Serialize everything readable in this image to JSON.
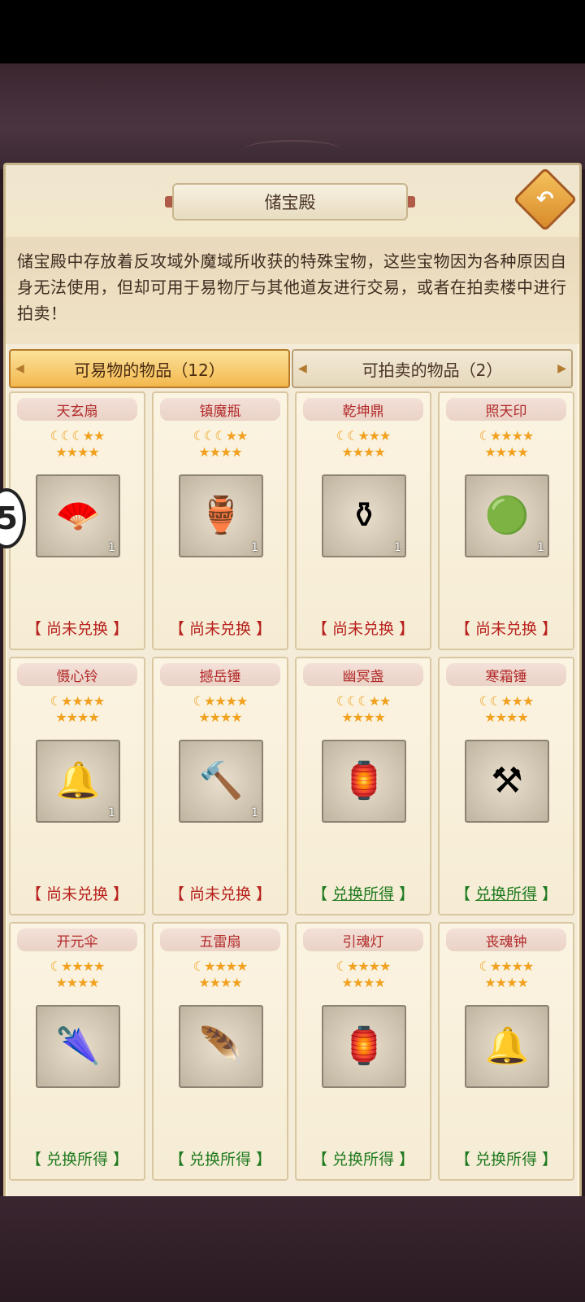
{
  "window": {
    "title": "储宝殿"
  },
  "description": "储宝殿中存放着反攻域外魔域所收获的特殊宝物，这些宝物因为各种原因自身无法使用，但却可用于易物厅与其他道友进行交易，或者在拍卖楼中进行拍卖！",
  "tabs": [
    {
      "label": "可易物的物品（12）",
      "active": true
    },
    {
      "label": "可拍卖的物品（2）",
      "active": false
    }
  ],
  "side_badge": "5",
  "items": [
    {
      "name": "天玄扇",
      "stars_row1": "☾☾☾★★",
      "stars_row2": "★★★★",
      "icon": "fan-icon",
      "glyph": "🪭",
      "count": "1",
      "status": "【 尚未兑换 】",
      "status_type": "pending"
    },
    {
      "name": "镇魔瓶",
      "stars_row1": "☾☾☾★★",
      "stars_row2": "★★★★",
      "icon": "vase-icon",
      "glyph": "🏺",
      "count": "1",
      "status": "【 尚未兑换 】",
      "status_type": "pending"
    },
    {
      "name": "乾坤鼎",
      "stars_row1": "☾☾★★★",
      "stars_row2": "★★★★",
      "icon": "cauldron-icon",
      "glyph": "⚱",
      "count": "1",
      "status": "【 尚未兑换 】",
      "status_type": "pending"
    },
    {
      "name": "照天印",
      "stars_row1": "☾★★★★",
      "stars_row2": "★★★★",
      "icon": "seal-icon",
      "glyph": "🟢",
      "count": "1",
      "status": "【 尚未兑换 】",
      "status_type": "pending"
    },
    {
      "name": "慑心铃",
      "stars_row1": "☾★★★★",
      "stars_row2": "★★★★",
      "icon": "bell-icon",
      "glyph": "🔔",
      "count": "1",
      "status": "【 尚未兑换 】",
      "status_type": "pending"
    },
    {
      "name": "撼岳锤",
      "stars_row1": "☾★★★★",
      "stars_row2": "★★★★",
      "icon": "hammer-icon",
      "glyph": "🔨",
      "count": "1",
      "status": "【 尚未兑换 】",
      "status_type": "pending"
    },
    {
      "name": "幽冥盏",
      "stars_row1": "☾☾☾★★",
      "stars_row2": "★★★★",
      "icon": "lantern-icon",
      "glyph": "🏮",
      "count": "",
      "status_open": "【 ",
      "status_link": "兑换所得",
      "status_close": " 】",
      "status": "",
      "status_type": "done"
    },
    {
      "name": "寒霜锤",
      "stars_row1": "☾☾★★★",
      "stars_row2": "★★★★",
      "icon": "axe-icon",
      "glyph": "⚒",
      "count": "",
      "status_open": "【 ",
      "status_link": "兑换所得",
      "status_close": " 】",
      "status": "",
      "status_type": "done"
    },
    {
      "name": "开元伞",
      "stars_row1": "☾★★★★",
      "stars_row2": "★★★★",
      "icon": "umbrella-icon",
      "glyph": "🌂",
      "count": "",
      "status": "【 兑换所得 】",
      "status_type": "done"
    },
    {
      "name": "五雷扇",
      "stars_row1": "☾★★★★",
      "stars_row2": "★★★★",
      "icon": "feather-fan-icon",
      "glyph": "🪶",
      "count": "",
      "status": "【 兑换所得 】",
      "status_type": "done"
    },
    {
      "name": "引魂灯",
      "stars_row1": "☾★★★★",
      "stars_row2": "★★★★",
      "icon": "lamp-icon",
      "glyph": "🏮",
      "count": "",
      "status": "【 兑换所得 】",
      "status_type": "done"
    },
    {
      "name": "丧魂钟",
      "stars_row1": "☾★★★★",
      "stars_row2": "★★★★",
      "icon": "gong-icon",
      "glyph": "🔔",
      "count": "",
      "status": "【 兑换所得 】",
      "status_type": "done"
    }
  ],
  "colors": {
    "pending": "#b8221e",
    "done": "#1f7a1f",
    "accent": "#f3b84e"
  }
}
